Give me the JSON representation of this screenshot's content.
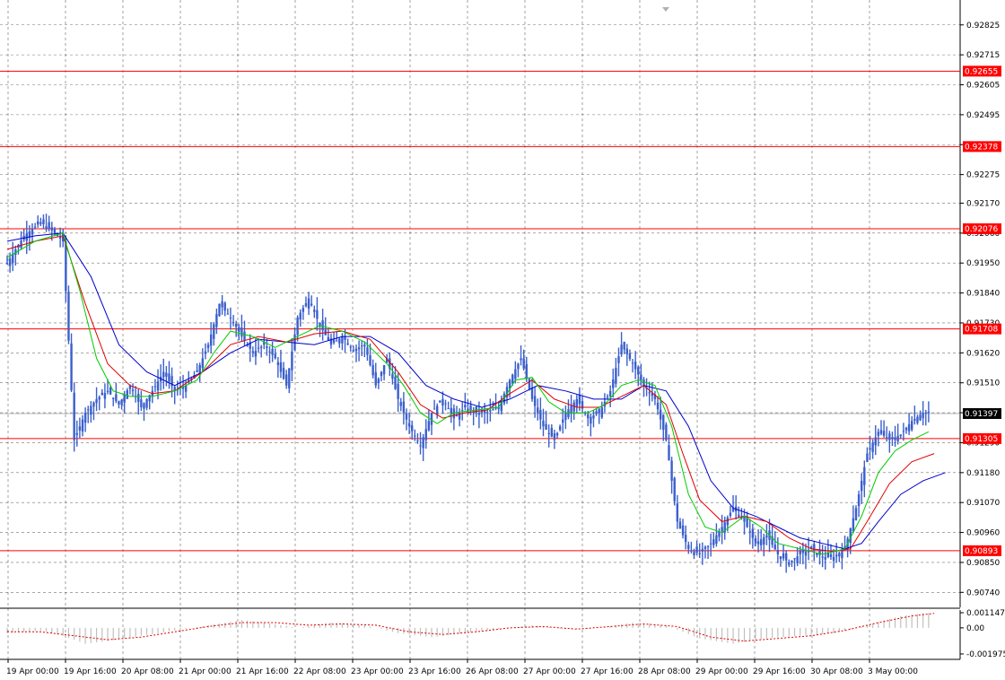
{
  "chart_data": {
    "type": "candlestick",
    "instrument_note": "",
    "y_axis": {
      "ylim": [
        0.90685,
        0.929
      ],
      "ticks": [
        "0.92825",
        "0.92715",
        "0.92605",
        "0.92495",
        "0.92385",
        "0.92275",
        "0.92170",
        "0.92060",
        "0.91950",
        "0.91840",
        "0.91730",
        "0.91620",
        "0.91510",
        "0.91400",
        "0.91290",
        "0.91180",
        "0.91070",
        "0.90960",
        "0.90850",
        "0.90740"
      ]
    },
    "x_axis": {
      "labels": [
        "19 Apr 00:00",
        "19 Apr 16:00",
        "20 Apr 08:00",
        "21 Apr 00:00",
        "21 Apr 16:00",
        "22 Apr 08:00",
        "23 Apr 00:00",
        "23 Apr 16:00",
        "26 Apr 08:00",
        "27 Apr 00:00",
        "27 Apr 16:00",
        "28 Apr 08:00",
        "29 Apr 00:00",
        "29 Apr 16:00",
        "30 Apr 08:00",
        "3 May 00:00"
      ]
    },
    "grid": true,
    "current_price": "0.91397",
    "levels": [
      {
        "label": "0.92655",
        "value": 0.92655
      },
      {
        "label": "0.92378",
        "value": 0.92378
      },
      {
        "label": "0.92076",
        "value": 0.92076
      },
      {
        "label": "0.91708",
        "value": 0.91708
      },
      {
        "label": "0.91305",
        "value": 0.91305
      },
      {
        "label": "0.90893",
        "value": 0.90893
      }
    ],
    "price_path": [
      [
        0,
        0.9195
      ],
      [
        3,
        0.9205
      ],
      [
        6,
        0.921
      ],
      [
        8,
        0.9207
      ],
      [
        10,
        0.9203
      ],
      [
        12,
        0.913
      ],
      [
        14,
        0.914
      ],
      [
        16,
        0.9145
      ],
      [
        18,
        0.9148
      ],
      [
        20,
        0.9143
      ],
      [
        22,
        0.915
      ],
      [
        24,
        0.9142
      ],
      [
        26,
        0.9148
      ],
      [
        28,
        0.9155
      ],
      [
        30,
        0.9148
      ],
      [
        32,
        0.915
      ],
      [
        34,
        0.9155
      ],
      [
        36,
        0.9165
      ],
      [
        38,
        0.918
      ],
      [
        40,
        0.9175
      ],
      [
        42,
        0.9168
      ],
      [
        44,
        0.9162
      ],
      [
        46,
        0.9165
      ],
      [
        48,
        0.916
      ],
      [
        50,
        0.915
      ],
      [
        52,
        0.9175
      ],
      [
        54,
        0.9182
      ],
      [
        56,
        0.9172
      ],
      [
        58,
        0.9165
      ],
      [
        60,
        0.9168
      ],
      [
        62,
        0.9163
      ],
      [
        64,
        0.9165
      ],
      [
        66,
        0.915
      ],
      [
        68,
        0.916
      ],
      [
        70,
        0.9145
      ],
      [
        72,
        0.9135
      ],
      [
        74,
        0.9128
      ],
      [
        76,
        0.914
      ],
      [
        78,
        0.9145
      ],
      [
        80,
        0.9138
      ],
      [
        82,
        0.9142
      ],
      [
        84,
        0.914
      ],
      [
        86,
        0.914
      ],
      [
        88,
        0.9142
      ],
      [
        90,
        0.9152
      ],
      [
        92,
        0.916
      ],
      [
        94,
        0.9145
      ],
      [
        96,
        0.9135
      ],
      [
        98,
        0.913
      ],
      [
        100,
        0.914
      ],
      [
        102,
        0.9145
      ],
      [
        104,
        0.9138
      ],
      [
        106,
        0.914
      ],
      [
        108,
        0.9148
      ],
      [
        110,
        0.9165
      ],
      [
        112,
        0.9158
      ],
      [
        114,
        0.915
      ],
      [
        116,
        0.9145
      ],
      [
        118,
        0.913
      ],
      [
        120,
        0.91
      ],
      [
        122,
        0.909
      ],
      [
        124,
        0.9088
      ],
      [
        126,
        0.9092
      ],
      [
        128,
        0.9098
      ],
      [
        130,
        0.9105
      ],
      [
        132,
        0.91
      ],
      [
        134,
        0.9092
      ],
      [
        136,
        0.9095
      ],
      [
        138,
        0.9088
      ],
      [
        140,
        0.9085
      ],
      [
        142,
        0.9088
      ],
      [
        144,
        0.909
      ],
      [
        146,
        0.9087
      ],
      [
        148,
        0.9087
      ],
      [
        150,
        0.909
      ],
      [
        152,
        0.9105
      ],
      [
        154,
        0.9125
      ],
      [
        156,
        0.9133
      ],
      [
        158,
        0.913
      ],
      [
        160,
        0.9132
      ],
      [
        162,
        0.9137
      ],
      [
        164,
        0.914
      ]
    ],
    "ma_green": [
      [
        0,
        0.9197
      ],
      [
        5,
        0.9203
      ],
      [
        10,
        0.9206
      ],
      [
        13,
        0.9185
      ],
      [
        16,
        0.916
      ],
      [
        19,
        0.9148
      ],
      [
        22,
        0.9146
      ],
      [
        26,
        0.9146
      ],
      [
        30,
        0.9148
      ],
      [
        34,
        0.9152
      ],
      [
        37,
        0.9162
      ],
      [
        40,
        0.917
      ],
      [
        44,
        0.9168
      ],
      [
        48,
        0.9164
      ],
      [
        52,
        0.9168
      ],
      [
        56,
        0.9172
      ],
      [
        60,
        0.917
      ],
      [
        64,
        0.9166
      ],
      [
        68,
        0.9158
      ],
      [
        71,
        0.915
      ],
      [
        74,
        0.914
      ],
      [
        77,
        0.9136
      ],
      [
        80,
        0.914
      ],
      [
        84,
        0.9141
      ],
      [
        88,
        0.9142
      ],
      [
        91,
        0.9152
      ],
      [
        94,
        0.9153
      ],
      [
        97,
        0.9144
      ],
      [
        100,
        0.914
      ],
      [
        104,
        0.914
      ],
      [
        107,
        0.9143
      ],
      [
        110,
        0.915
      ],
      [
        113,
        0.9152
      ],
      [
        116,
        0.915
      ],
      [
        119,
        0.9135
      ],
      [
        122,
        0.911
      ],
      [
        125,
        0.9098
      ],
      [
        128,
        0.9096
      ],
      [
        132,
        0.9102
      ],
      [
        135,
        0.9098
      ],
      [
        138,
        0.9092
      ],
      [
        142,
        0.909
      ],
      [
        146,
        0.9088
      ],
      [
        150,
        0.909
      ],
      [
        153,
        0.9102
      ],
      [
        156,
        0.9118
      ],
      [
        159,
        0.9126
      ],
      [
        162,
        0.913
      ],
      [
        165,
        0.9133
      ]
    ],
    "ma_red": [
      [
        0,
        0.92
      ],
      [
        5,
        0.9203
      ],
      [
        10,
        0.9205
      ],
      [
        14,
        0.918
      ],
      [
        18,
        0.9158
      ],
      [
        22,
        0.915
      ],
      [
        26,
        0.9147
      ],
      [
        30,
        0.9148
      ],
      [
        35,
        0.9155
      ],
      [
        40,
        0.9165
      ],
      [
        45,
        0.9168
      ],
      [
        50,
        0.9166
      ],
      [
        55,
        0.9169
      ],
      [
        60,
        0.917
      ],
      [
        65,
        0.9167
      ],
      [
        70,
        0.9155
      ],
      [
        74,
        0.9143
      ],
      [
        78,
        0.9138
      ],
      [
        82,
        0.914
      ],
      [
        86,
        0.9141
      ],
      [
        90,
        0.9147
      ],
      [
        94,
        0.9152
      ],
      [
        98,
        0.9145
      ],
      [
        102,
        0.9142
      ],
      [
        106,
        0.9142
      ],
      [
        110,
        0.9146
      ],
      [
        114,
        0.915
      ],
      [
        118,
        0.9143
      ],
      [
        121,
        0.9125
      ],
      [
        124,
        0.9108
      ],
      [
        128,
        0.91
      ],
      [
        132,
        0.9102
      ],
      [
        136,
        0.91
      ],
      [
        140,
        0.9094
      ],
      [
        144,
        0.909
      ],
      [
        148,
        0.9089
      ],
      [
        151,
        0.909
      ],
      [
        154,
        0.91
      ],
      [
        158,
        0.9114
      ],
      [
        162,
        0.9122
      ],
      [
        166,
        0.9125
      ]
    ],
    "ma_blue": [
      [
        0,
        0.9203
      ],
      [
        5,
        0.9205
      ],
      [
        10,
        0.9206
      ],
      [
        15,
        0.919
      ],
      [
        20,
        0.9165
      ],
      [
        25,
        0.9155
      ],
      [
        30,
        0.915
      ],
      [
        35,
        0.9155
      ],
      [
        40,
        0.9162
      ],
      [
        45,
        0.9167
      ],
      [
        50,
        0.9166
      ],
      [
        55,
        0.9165
      ],
      [
        60,
        0.9168
      ],
      [
        65,
        0.9168
      ],
      [
        70,
        0.9162
      ],
      [
        75,
        0.915
      ],
      [
        80,
        0.9145
      ],
      [
        85,
        0.9142
      ],
      [
        90,
        0.9145
      ],
      [
        95,
        0.915
      ],
      [
        100,
        0.9148
      ],
      [
        105,
        0.9145
      ],
      [
        110,
        0.9145
      ],
      [
        114,
        0.915
      ],
      [
        118,
        0.9148
      ],
      [
        122,
        0.9135
      ],
      [
        126,
        0.9115
      ],
      [
        130,
        0.9105
      ],
      [
        134,
        0.9102
      ],
      [
        138,
        0.9098
      ],
      [
        142,
        0.9094
      ],
      [
        146,
        0.9092
      ],
      [
        150,
        0.909
      ],
      [
        153,
        0.9092
      ],
      [
        156,
        0.91
      ],
      [
        160,
        0.911
      ],
      [
        164,
        0.9115
      ],
      [
        168,
        0.9118
      ]
    ],
    "oscillator": {
      "ticks": [
        "0.001147",
        "0.00",
        "-0.001975"
      ],
      "ylim": [
        -0.00225,
        0.00135
      ],
      "hist": [
        [
          0,
          -0.0004
        ],
        [
          6,
          -0.0002
        ],
        [
          10,
          -0.0006
        ],
        [
          14,
          -0.0012
        ],
        [
          18,
          -0.001
        ],
        [
          24,
          -0.0006
        ],
        [
          30,
          -0.0002
        ],
        [
          36,
          0.0002
        ],
        [
          42,
          0.0006
        ],
        [
          46,
          0.0004
        ],
        [
          52,
          0.0
        ],
        [
          58,
          0.0004
        ],
        [
          64,
          0.0002
        ],
        [
          70,
          -0.0004
        ],
        [
          76,
          -0.0007
        ],
        [
          82,
          -0.0004
        ],
        [
          88,
          -0.0001
        ],
        [
          94,
          0.0002
        ],
        [
          100,
          -0.0001
        ],
        [
          106,
          0.0
        ],
        [
          112,
          0.0004
        ],
        [
          118,
          0.0002
        ],
        [
          124,
          -0.0008
        ],
        [
          130,
          -0.0012
        ],
        [
          136,
          -0.0008
        ],
        [
          142,
          -0.0006
        ],
        [
          148,
          -0.0004
        ],
        [
          154,
          0.0002
        ],
        [
          160,
          0.0009
        ],
        [
          164,
          0.0011
        ]
      ],
      "signal": [
        [
          0,
          -0.0003
        ],
        [
          6,
          -0.0003
        ],
        [
          12,
          -0.0006
        ],
        [
          18,
          -0.0009
        ],
        [
          24,
          -0.0007
        ],
        [
          30,
          -0.0003
        ],
        [
          36,
          0.0001
        ],
        [
          42,
          0.0004
        ],
        [
          48,
          0.0004
        ],
        [
          54,
          0.0002
        ],
        [
          60,
          0.0003
        ],
        [
          66,
          0.0002
        ],
        [
          72,
          -0.0003
        ],
        [
          78,
          -0.0005
        ],
        [
          84,
          -0.0003
        ],
        [
          90,
          0.0
        ],
        [
          96,
          0.0001
        ],
        [
          102,
          -0.0001
        ],
        [
          108,
          0.0001
        ],
        [
          114,
          0.0003
        ],
        [
          120,
          0.0001
        ],
        [
          126,
          -0.0007
        ],
        [
          132,
          -0.001
        ],
        [
          138,
          -0.0008
        ],
        [
          144,
          -0.0006
        ],
        [
          150,
          -0.0002
        ],
        [
          156,
          0.0004
        ],
        [
          162,
          0.0009
        ],
        [
          166,
          0.0011
        ]
      ]
    }
  },
  "colors": {
    "candle": "#3a5fcd",
    "ma_green": "#00cc00",
    "ma_red": "#e00000",
    "ma_blue": "#0000cc",
    "level": "#ff0000",
    "grid": "#000000",
    "hist": "#c0c0c0",
    "signal": "#e00000",
    "current_bg": "#000000",
    "level_bg": "#ff0000"
  }
}
